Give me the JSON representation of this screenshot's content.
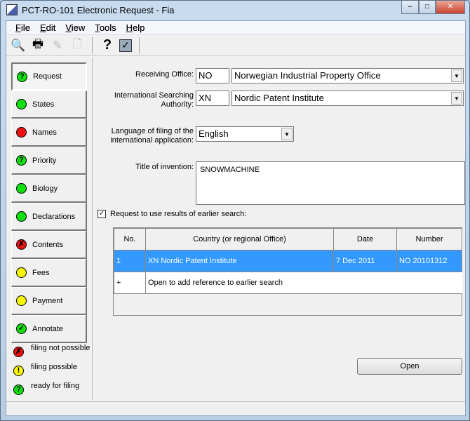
{
  "window": {
    "title": "PCT-RO-101 Electronic Request - Fia",
    "minimize": "–",
    "maximize": "□",
    "close": "✕"
  },
  "menu": [
    {
      "label": "File",
      "key": "F",
      "rest": "ile"
    },
    {
      "label": "Edit",
      "key": "E",
      "rest": "dit"
    },
    {
      "label": "View",
      "key": "V",
      "rest": "iew"
    },
    {
      "label": "Tools",
      "key": "T",
      "rest": "ools"
    },
    {
      "label": "Help",
      "key": "H",
      "rest": "elp"
    }
  ],
  "toolbar": [
    "print-preview-icon",
    "print-icon",
    "edit-disabled-icon",
    "new-document-disabled-icon",
    "help-icon",
    "validate-icon"
  ],
  "tabs": [
    {
      "label": "Request",
      "status": "ready",
      "glyph": "?"
    },
    {
      "label": "States",
      "status": "ok",
      "glyph": ""
    },
    {
      "label": "Names",
      "status": "error",
      "glyph": ""
    },
    {
      "label": "Priority",
      "status": "ready",
      "glyph": "?"
    },
    {
      "label": "Biology",
      "status": "ok",
      "glyph": ""
    },
    {
      "label": "Declarations",
      "status": "ok",
      "glyph": ""
    },
    {
      "label": "Contents",
      "status": "not-possible",
      "glyph": "✗"
    },
    {
      "label": "Fees",
      "status": "warning",
      "glyph": ""
    },
    {
      "label": "Payment",
      "status": "warning",
      "glyph": ""
    },
    {
      "label": "Annotate",
      "status": "checked",
      "glyph": "✓"
    }
  ],
  "legend": [
    {
      "label": "filing not possible",
      "glyph": "✗",
      "color": "red"
    },
    {
      "label": "filing possible",
      "glyph": "!",
      "color": "yellow"
    },
    {
      "label": "ready for filing",
      "glyph": "?",
      "color": "green"
    }
  ],
  "form": {
    "receiving_office_label": "Receiving Office:",
    "receiving_office_code": "NO",
    "receiving_office_name": "Norwegian Industrial Property Office",
    "isa_label_1": "International Searching",
    "isa_label_2": "Authority:",
    "isa_code": "XN",
    "isa_name": "Nordic Patent Institute",
    "language_label_1": "Language of filing of the",
    "language_label_2": "international application:",
    "language": "English",
    "title_label": "Title of invention:",
    "title": "SNOWMACHINE",
    "earlier_search_label": "Request to use results of earlier search:",
    "earlier_search_checked": true
  },
  "table": {
    "headers": [
      "No.",
      "Country (or regional Office)",
      "Date",
      "Number"
    ],
    "rows": [
      [
        "1",
        "XN Nordic Patent Institute",
        "7 Dec 2011",
        "NO 20101312"
      ]
    ],
    "add_row": [
      "+",
      "Open to add reference to earlier search"
    ]
  },
  "open_button": "Open",
  "colors": {
    "selected": "#3399ff",
    "green": "#10e010",
    "red": "#f01010",
    "yellow": "#f8f800"
  }
}
